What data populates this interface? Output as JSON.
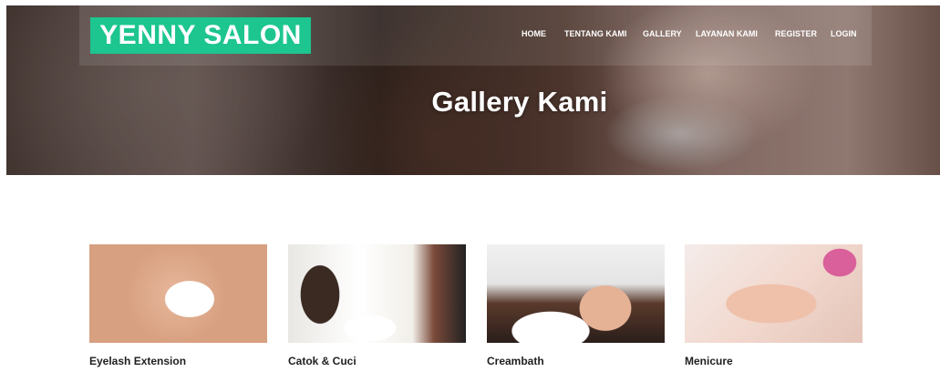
{
  "header": {
    "logo_text": "YENNY SALON",
    "nav": [
      "HOME",
      "TENTANG KAMI",
      "GALLERY",
      "LAYANAN KAMI",
      "REGISTER",
      "LOGIN"
    ]
  },
  "hero": {
    "title": "Gallery Kami"
  },
  "gallery": {
    "items": [
      {
        "label": "Eyelash Extension",
        "image": "eyelash-photo"
      },
      {
        "label": "Catok & Cuci",
        "image": "salon-hair-photo"
      },
      {
        "label": "Creambath",
        "image": "hair-wash-photo"
      },
      {
        "label": "Menicure",
        "image": "manicure-photo"
      }
    ]
  },
  "colors": {
    "logo_bg": "#1dc58f",
    "nav_text": "#ffffff"
  }
}
